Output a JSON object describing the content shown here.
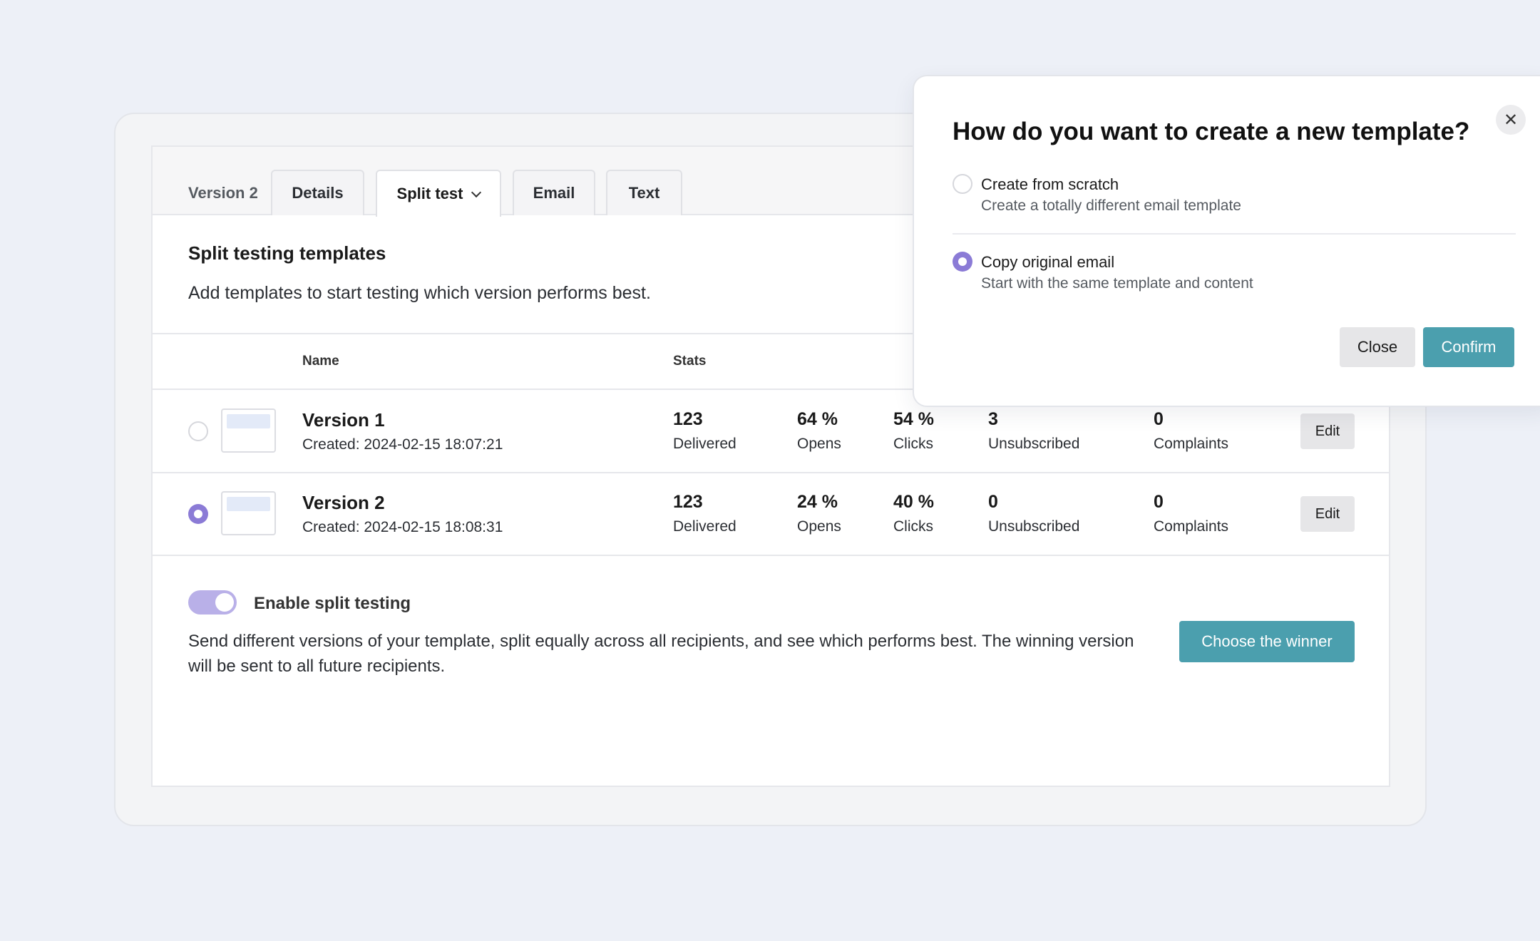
{
  "tabs": {
    "version_label": "Version 2",
    "items": [
      {
        "label": "Details"
      },
      {
        "label": "Split test"
      },
      {
        "label": "Email"
      },
      {
        "label": "Text"
      }
    ]
  },
  "section": {
    "title": "Split testing templates",
    "description": "Add templates to start testing which version performs best."
  },
  "table": {
    "headers": {
      "name": "Name",
      "stats": "Stats"
    },
    "rows": [
      {
        "selected": false,
        "name": "Version 1",
        "created": "Created: 2024-02-15 18:07:21",
        "delivered": "123",
        "delivered_label": "Delivered",
        "opens": "64 %",
        "opens_label": "Opens",
        "clicks": "54 %",
        "clicks_label": "Clicks",
        "unsubscribed": "3",
        "unsubscribed_label": "Unsubscribed",
        "complaints": "0",
        "complaints_label": "Complaints",
        "edit_label": "Edit"
      },
      {
        "selected": true,
        "name": "Version 2",
        "created": "Created: 2024-02-15 18:08:31",
        "delivered": "123",
        "delivered_label": "Delivered",
        "opens": "24 %",
        "opens_label": "Opens",
        "clicks": "40 %",
        "clicks_label": "Clicks",
        "unsubscribed": "0",
        "unsubscribed_label": "Unsubscribed",
        "complaints": "0",
        "complaints_label": "Complaints",
        "edit_label": "Edit"
      }
    ]
  },
  "split": {
    "toggle_label": "Enable split testing",
    "enabled": true,
    "description": "Send different versions of your template, split equally across all recipients, and see which performs best. The winning version will be sent to all future recipients.",
    "winner_button": "Choose the winner"
  },
  "modal": {
    "title": "How do you want to create a new template?",
    "close_icon": "close-icon",
    "options": [
      {
        "title": "Create from scratch",
        "description": "Create a totally different email template",
        "selected": false
      },
      {
        "title": "Copy original email",
        "description": "Start with the same template and content",
        "selected": true
      }
    ],
    "close_button": "Close",
    "confirm_button": "Confirm"
  },
  "colors": {
    "accent": "#4b9fae",
    "radio_selected": "#8b7bd6",
    "toggle_track": "#b9b0e8",
    "background": "#edf0f7"
  }
}
